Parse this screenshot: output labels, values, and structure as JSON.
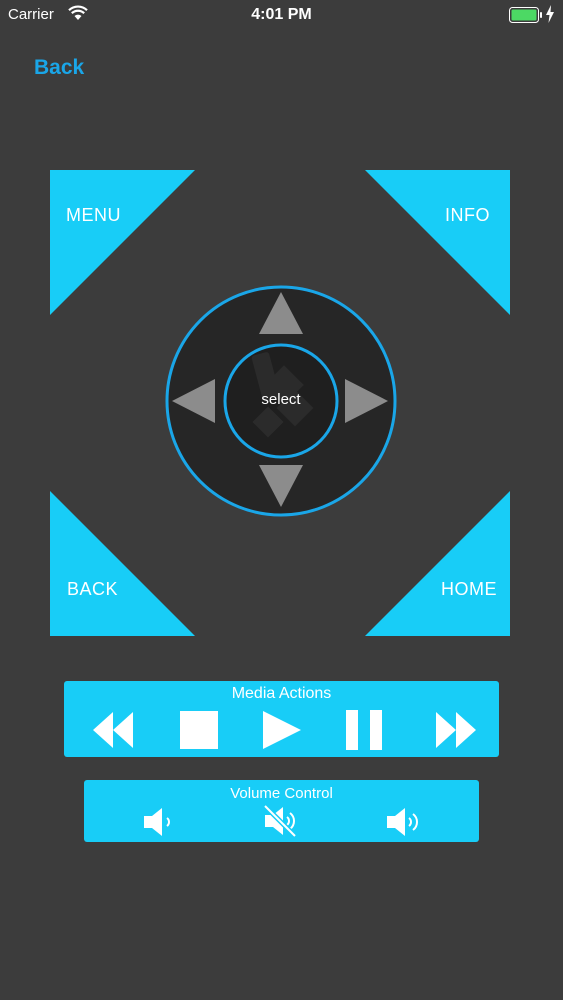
{
  "status_bar": {
    "carrier": "Carrier",
    "time": "4:01 PM"
  },
  "nav": {
    "back_label": "Back"
  },
  "corners": {
    "menu": "MENU",
    "info": "INFO",
    "back": "BACK",
    "home": "HOME"
  },
  "dpad": {
    "select_label": "select"
  },
  "media": {
    "title": "Media Actions"
  },
  "volume": {
    "title": "Volume Control"
  },
  "colors": {
    "background": "#3c3c3c",
    "accent": "#18cdf7",
    "nav_link": "#1aa6e8",
    "dpad_ring": "#1aa6e8",
    "arrow": "#8c8c8c"
  },
  "icons": {
    "media": [
      "rewind-icon",
      "stop-icon",
      "play-icon",
      "pause-icon",
      "fast-forward-icon"
    ],
    "volume": [
      "volume-down-icon",
      "mute-icon",
      "volume-up-icon"
    ]
  }
}
